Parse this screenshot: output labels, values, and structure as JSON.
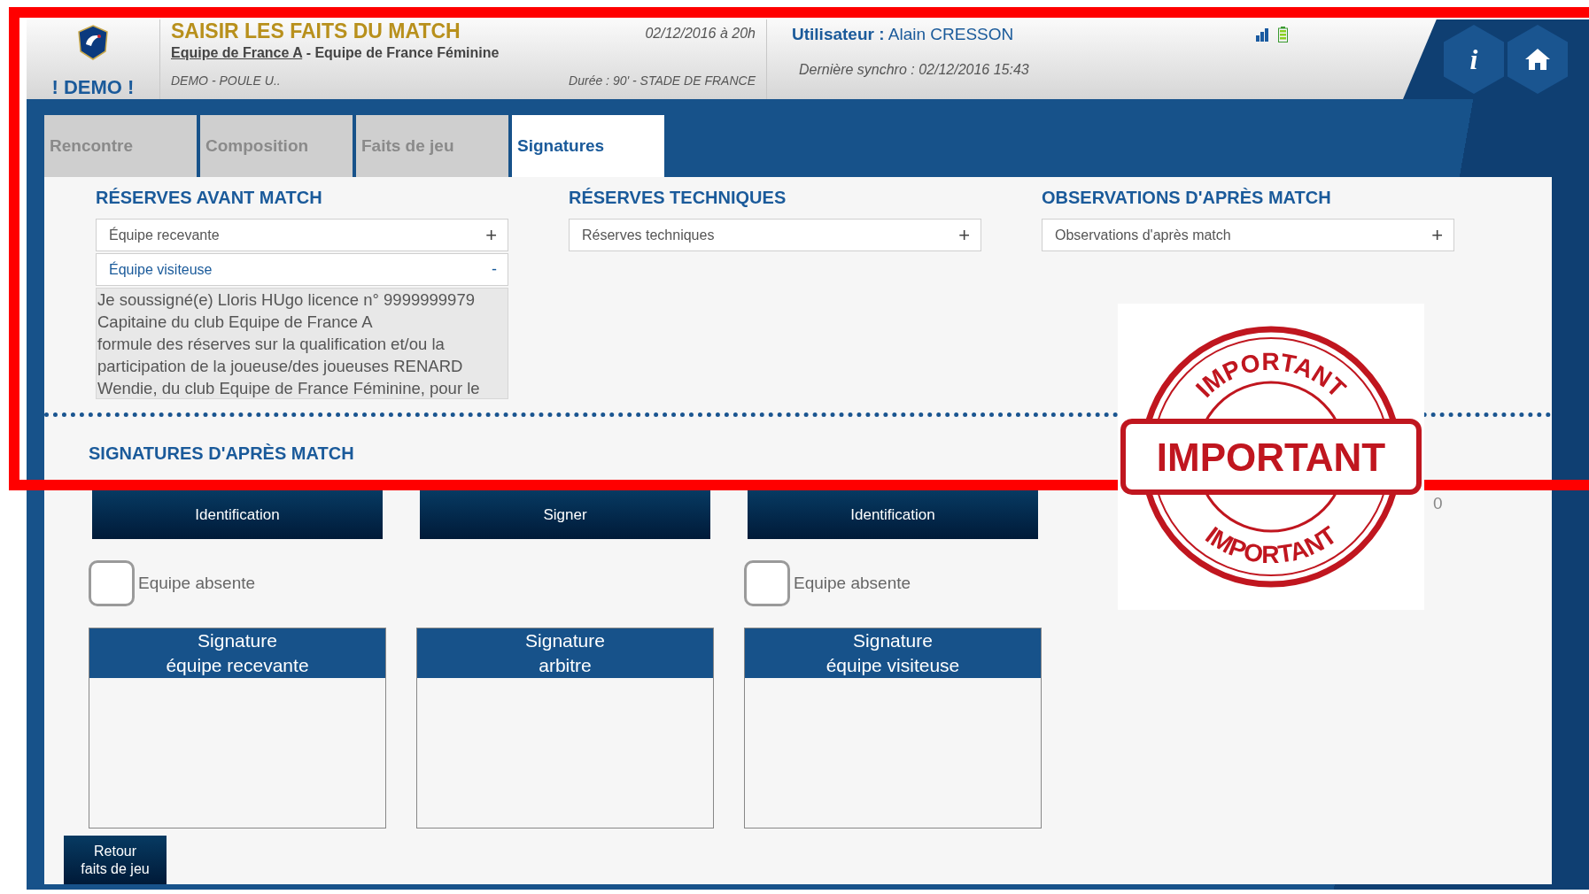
{
  "header": {
    "demo_label": "! DEMO !",
    "title": "SAISIR LES FAITS DU MATCH",
    "date": "02/12/2016 à 20h",
    "home_team": "Equipe de France A",
    "separator": " - ",
    "away_team": "Equipe de France Féminine",
    "competition": "DEMO - POULE U..",
    "details": "Durée : 90' - STADE DE FRANCE",
    "user_label": "Utilisateur :",
    "user_name": "Alain CRESSON",
    "sync": "Dernière synchro : 02/12/2016 15:43",
    "info_button": "i"
  },
  "tabs": [
    {
      "label": "Rencontre",
      "selected": false
    },
    {
      "label": "Composition",
      "selected": false
    },
    {
      "label": "Faits de jeu",
      "selected": false
    },
    {
      "label": "Signatures",
      "selected": true
    }
  ],
  "reserve_sections": [
    {
      "title": "RÉSERVES AVANT MATCH",
      "items": [
        {
          "label": "Équipe recevante",
          "toggle": "+",
          "expanded": false
        },
        {
          "label": "Équipe visiteuse",
          "toggle": "-",
          "expanded": true,
          "value": "Je soussigné(e) Lloris HUgo licence n° 9999999979\nCapitaine du club Equipe de France A\nformule des réserves sur la qualification et/ou la\nparticipation de la joueuse/des joueuses RENARD\nWendie, du club Equipe de France Féminine, pour le"
        }
      ]
    },
    {
      "title": "RÉSERVES TECHNIQUES",
      "items": [
        {
          "label": "Réserves techniques",
          "toggle": "+",
          "expanded": false
        }
      ]
    },
    {
      "title": "OBSERVATIONS D'APRÈS MATCH",
      "items": [
        {
          "label": "Observations d'après match",
          "toggle": "+",
          "expanded": false
        }
      ]
    }
  ],
  "signatures": {
    "title": "SIGNATURES D'APRÈS MATCH",
    "counter": "0",
    "columns": [
      {
        "button": "Identification",
        "absent_label": "Equipe absente",
        "checked": false,
        "pad_title": "Signature\néquipe recevante"
      },
      {
        "button": "Signer",
        "pad_title": "Signature\narbitre"
      },
      {
        "button": "Identification",
        "absent_label": "Equipe absente",
        "checked": false,
        "pad_title": "Signature\néquipe visiteuse"
      }
    ]
  },
  "back_button": "Retour\nfaits de jeu",
  "stamp": {
    "ring_top": "IMPORTANT",
    "center": "IMPORTANT",
    "ring_bottom": "IMPORTANT"
  }
}
